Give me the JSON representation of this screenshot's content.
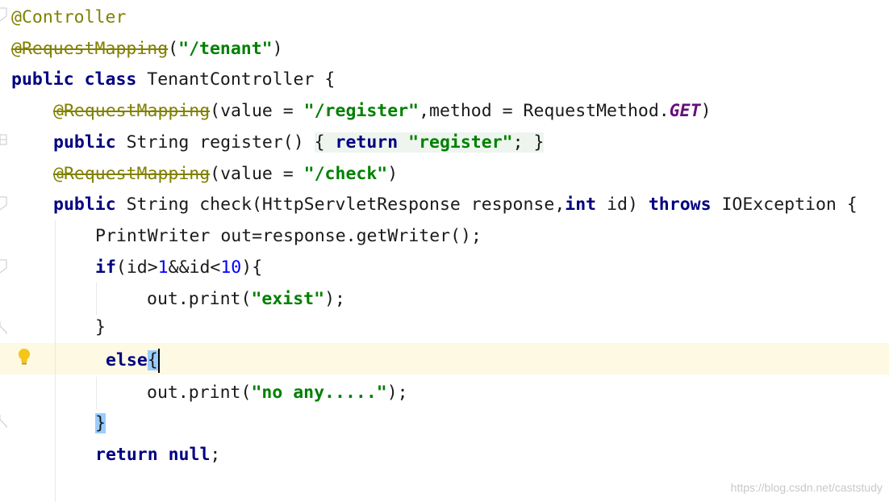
{
  "editor": {
    "lines": [
      {
        "segments": [
          {
            "t": "@Controller",
            "c": "ann"
          }
        ]
      },
      {
        "segments": [
          {
            "t": "@RequestMapping",
            "c": "ann strike"
          },
          {
            "t": "(",
            "c": ""
          },
          {
            "t": "\"/tenant\"",
            "c": "str"
          },
          {
            "t": ")",
            "c": ""
          }
        ]
      },
      {
        "segments": [
          {
            "t": "public class",
            "c": "kw"
          },
          {
            "t": " TenantController {",
            "c": ""
          }
        ]
      },
      {
        "segments": [
          {
            "t": "@RequestMapping",
            "c": "ann strike"
          },
          {
            "t": "(value = ",
            "c": ""
          },
          {
            "t": "\"/register\"",
            "c": "str"
          },
          {
            "t": ",method = RequestMethod.",
            "c": ""
          },
          {
            "t": "GET",
            "c": "itl"
          },
          {
            "t": ")",
            "c": ""
          }
        ]
      },
      {
        "segments": [
          {
            "t": "public",
            "c": "kw"
          },
          {
            "t": " String register() ",
            "c": ""
          },
          {
            "t": "{ ",
            "c": "fold-inline"
          },
          {
            "t": "return",
            "c": "kw fold-inline"
          },
          {
            "t": " ",
            "c": "fold-inline"
          },
          {
            "t": "\"register\"",
            "c": "str fold-inline"
          },
          {
            "t": "; }",
            "c": "fold-inline"
          }
        ]
      },
      {
        "segments": [
          {
            "t": "@RequestMapping",
            "c": "ann strike"
          },
          {
            "t": "(value = ",
            "c": ""
          },
          {
            "t": "\"/check\"",
            "c": "str"
          },
          {
            "t": ")",
            "c": ""
          }
        ]
      },
      {
        "segments": [
          {
            "t": "public",
            "c": "kw"
          },
          {
            "t": " String check(HttpServletResponse response,",
            "c": ""
          },
          {
            "t": "int",
            "c": "kw"
          },
          {
            "t": " id) ",
            "c": ""
          },
          {
            "t": "throws",
            "c": "kw"
          },
          {
            "t": " IOException {",
            "c": ""
          }
        ]
      },
      {
        "segments": [
          {
            "t": "PrintWriter out=response.getWriter();",
            "c": ""
          }
        ]
      },
      {
        "segments": [
          {
            "t": "if",
            "c": "kw"
          },
          {
            "t": "(id>",
            "c": ""
          },
          {
            "t": "1",
            "c": "num"
          },
          {
            "t": "&&id<",
            "c": ""
          },
          {
            "t": "10",
            "c": "num"
          },
          {
            "t": "){",
            "c": ""
          }
        ]
      },
      {
        "segments": [
          {
            "t": "out.print(",
            "c": ""
          },
          {
            "t": "\"exist\"",
            "c": "str"
          },
          {
            "t": ");",
            "c": ""
          }
        ]
      },
      {
        "segments": [
          {
            "t": "}",
            "c": ""
          }
        ]
      },
      {
        "segments": [
          {
            "t": "else",
            "c": "kw"
          },
          {
            "t": "{",
            "c": "brace-match"
          }
        ]
      },
      {
        "segments": [
          {
            "t": "out.print(",
            "c": ""
          },
          {
            "t": "\"no any.....\"",
            "c": "str"
          },
          {
            "t": ");",
            "c": ""
          }
        ]
      },
      {
        "segments": [
          {
            "t": "}",
            "c": "brace-match"
          }
        ]
      },
      {
        "segments": [
          {
            "t": "return null",
            "c": "kw"
          },
          {
            "t": ";",
            "c": ""
          }
        ]
      }
    ]
  },
  "colors": {
    "keyword": "#000080",
    "annotation": "#808000",
    "string": "#008000",
    "number": "#0000ff",
    "enum_constant": "#660e7a",
    "current_line": "#fdf9e2",
    "brace_match": "#99ccff"
  },
  "icons": {
    "intention_bulb": "lightbulb-icon",
    "fold_marker": "fold-marker-icon"
  },
  "watermark": "https://blog.csdn.net/caststudy"
}
